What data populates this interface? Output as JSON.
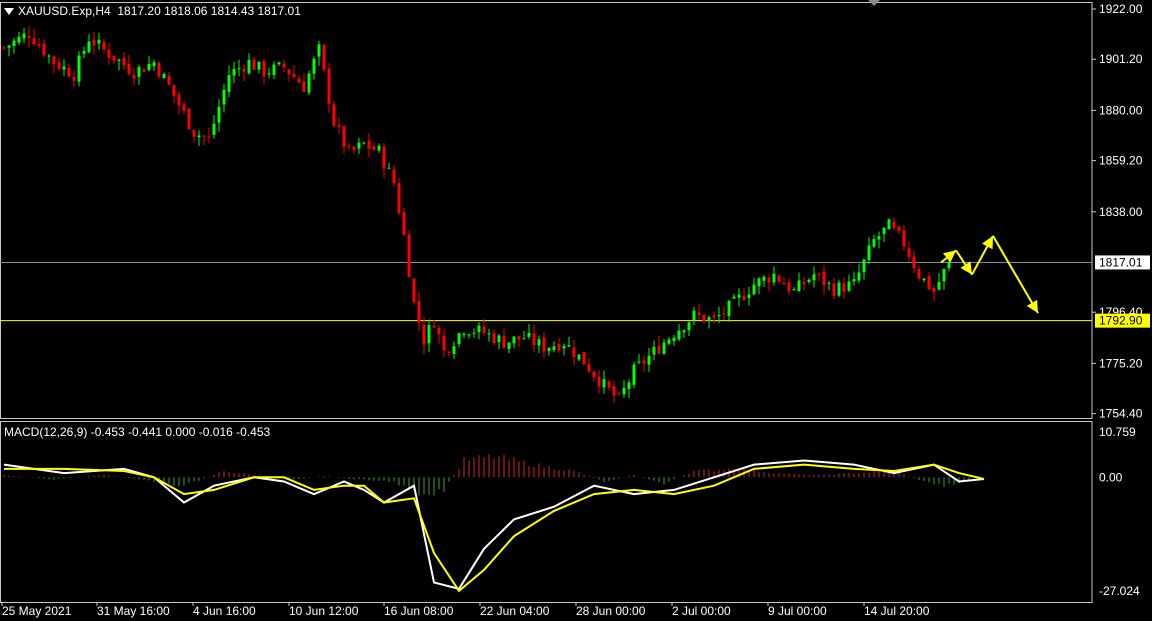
{
  "header": {
    "symbol": "XAUUSD.Exp,H4",
    "ohlc": "1817.20 1818.06 1814.43 1817.01"
  },
  "macd": {
    "label": "MACD(12,26,9) -0.453 -0.441 0.000 -0.016 -0.453"
  },
  "colors": {
    "bull": "#00ff00",
    "bear": "#ff0000",
    "macd_line": "#ffffff",
    "signal_line": "#ffff00",
    "hist_pos": "#8b1a1a",
    "hist_neg": "#2e6b1e",
    "current_price_box": "#ffffff",
    "level_line": "#ffff00",
    "arrows": "#ffff00"
  },
  "chart_data": [
    {
      "type": "candlestick",
      "symbol": "XAUUSD.Exp",
      "timeframe": "H4",
      "y_ticks": [
        "1922.00",
        "1901.20",
        "1880.00",
        "1859.20",
        "1838.00",
        "1817.01",
        "1796.40",
        "1792.90",
        "1775.20",
        "1754.40"
      ],
      "ylim": [
        1749,
        1924
      ],
      "x_ticks": [
        "25 May 2021",
        "31 May 16:00",
        "4 Jun 16:00",
        "10 Jun 12:00",
        "16 Jun 08:00",
        "22 Jun 04:00",
        "28 Jun 00:00",
        "2 Jul 00:00",
        "9 Jul 00:00",
        "14 Jul 20:00"
      ],
      "current_price": 1817.01,
      "horizontal_level": 1792.9,
      "close_path": [
        [
          0,
          1906
        ],
        [
          5,
          1912
        ],
        [
          10,
          1900
        ],
        [
          14,
          1895
        ],
        [
          17,
          1910
        ],
        [
          20,
          1905
        ],
        [
          26,
          1896
        ],
        [
          30,
          1900
        ],
        [
          33,
          1890
        ],
        [
          38,
          1871
        ],
        [
          41,
          1868
        ],
        [
          45,
          1895
        ],
        [
          49,
          1900
        ],
        [
          52,
          1896
        ],
        [
          56,
          1898
        ],
        [
          60,
          1890
        ],
        [
          63,
          1905
        ],
        [
          66,
          1875
        ],
        [
          69,
          1862
        ],
        [
          72,
          1866
        ],
        [
          75,
          1863
        ],
        [
          78,
          1850
        ],
        [
          80,
          1828
        ],
        [
          82,
          1800
        ],
        [
          84,
          1785
        ],
        [
          86,
          1793
        ],
        [
          88,
          1780
        ],
        [
          92,
          1790
        ],
        [
          96,
          1788
        ],
        [
          100,
          1784
        ],
        [
          104,
          1786
        ],
        [
          108,
          1782
        ],
        [
          112,
          1784
        ],
        [
          116,
          1776
        ],
        [
          120,
          1766
        ],
        [
          123,
          1760
        ],
        [
          126,
          1772
        ],
        [
          130,
          1780
        ],
        [
          134,
          1788
        ],
        [
          138,
          1795
        ],
        [
          142,
          1793
        ],
        [
          146,
          1800
        ],
        [
          150,
          1808
        ],
        [
          154,
          1812
        ],
        [
          158,
          1805
        ],
        [
          162,
          1812
        ],
        [
          166,
          1806
        ],
        [
          170,
          1808
        ],
        [
          174,
          1826
        ],
        [
          177,
          1832
        ],
        [
          180,
          1825
        ],
        [
          183,
          1812
        ],
        [
          186,
          1805
        ],
        [
          189,
          1817
        ]
      ],
      "forecast_arrows": [
        [
          1817,
          1822
        ],
        [
          1822,
          1812
        ],
        [
          1812,
          1828
        ],
        [
          1828,
          1796
        ]
      ]
    },
    {
      "type": "line",
      "name": "MACD(12,26,9)",
      "y_ticks": [
        "10.759",
        "0.00",
        "-27.024"
      ],
      "ylim": [
        -27.024,
        10.759
      ],
      "series": [
        {
          "name": "main",
          "points": [
            [
              0,
              3
            ],
            [
              12,
              1
            ],
            [
              24,
              2
            ],
            [
              30,
              0
            ],
            [
              36,
              -6
            ],
            [
              42,
              -2
            ],
            [
              50,
              0
            ],
            [
              56,
              -1
            ],
            [
              62,
              -4
            ],
            [
              68,
              -1
            ],
            [
              72,
              -3
            ],
            [
              76,
              -6
            ],
            [
              82,
              -2
            ],
            [
              86,
              -25
            ],
            [
              91,
              -26.5
            ],
            [
              96,
              -17
            ],
            [
              102,
              -10
            ],
            [
              110,
              -7
            ],
            [
              118,
              -2
            ],
            [
              126,
              -4
            ],
            [
              134,
              -3
            ],
            [
              142,
              0
            ],
            [
              150,
              3
            ],
            [
              160,
              4
            ],
            [
              170,
              3
            ],
            [
              178,
              1
            ],
            [
              186,
              3
            ],
            [
              191,
              -1
            ],
            [
              196,
              -0.4
            ]
          ]
        },
        {
          "name": "signal",
          "points": [
            [
              0,
              2
            ],
            [
              12,
              2
            ],
            [
              24,
              1.5
            ],
            [
              30,
              0
            ],
            [
              36,
              -4
            ],
            [
              42,
              -3
            ],
            [
              50,
              0
            ],
            [
              56,
              0
            ],
            [
              62,
              -3
            ],
            [
              68,
              -2
            ],
            [
              72,
              -2
            ],
            [
              76,
              -6
            ],
            [
              82,
              -5
            ],
            [
              86,
              -18
            ],
            [
              91,
              -27
            ],
            [
              96,
              -22
            ],
            [
              102,
              -14
            ],
            [
              110,
              -8
            ],
            [
              118,
              -4
            ],
            [
              126,
              -3
            ],
            [
              134,
              -4
            ],
            [
              142,
              -2
            ],
            [
              150,
              2
            ],
            [
              160,
              3
            ],
            [
              170,
              2
            ],
            [
              178,
              1.5
            ],
            [
              186,
              3
            ],
            [
              191,
              1
            ],
            [
              196,
              -0.4
            ]
          ]
        }
      ],
      "histogram": [
        [
          0,
          0.5
        ],
        [
          10,
          -0.5
        ],
        [
          20,
          0.6
        ],
        [
          30,
          -1
        ],
        [
          36,
          -2
        ],
        [
          44,
          1.5
        ],
        [
          50,
          0.5
        ],
        [
          58,
          -0.5
        ],
        [
          64,
          0.3
        ],
        [
          70,
          -0.5
        ],
        [
          78,
          -1
        ],
        [
          84,
          -5
        ],
        [
          88,
          -3
        ],
        [
          92,
          4
        ],
        [
          98,
          5
        ],
        [
          106,
          3
        ],
        [
          114,
          1.5
        ],
        [
          120,
          -1
        ],
        [
          126,
          0.5
        ],
        [
          132,
          -1.5
        ],
        [
          138,
          1.5
        ],
        [
          146,
          2
        ],
        [
          154,
          1
        ],
        [
          162,
          0.5
        ],
        [
          170,
          1
        ],
        [
          178,
          1.5
        ],
        [
          184,
          -1
        ],
        [
          188,
          -2
        ],
        [
          194,
          -0.5
        ]
      ]
    }
  ]
}
